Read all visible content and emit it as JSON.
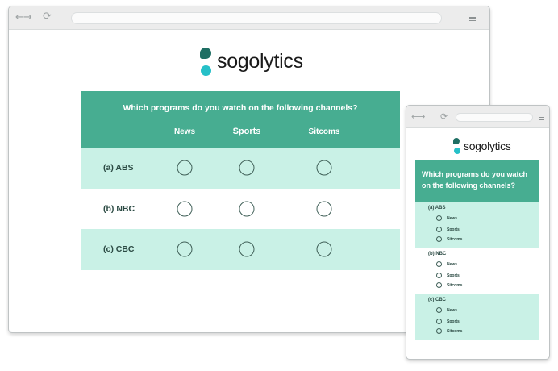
{
  "brand": {
    "name": "sogolytics",
    "colors": {
      "primary": "#47ad91",
      "mint": "#c9f1e6",
      "logo_dark": "#1e6e63",
      "logo_light": "#26c0c8"
    }
  },
  "browser": {
    "back_forward_icon": "back-forward-arrows",
    "back_forward_glyph": "←→",
    "reload_icon": "reload",
    "reload_glyph": "⟳",
    "menu_icon": "hamburger-menu"
  },
  "desktop": {
    "question": "Which programs do you watch on the  following channels?",
    "columns": [
      "News",
      "Sports",
      "Sitcoms"
    ],
    "rows": [
      "(a) ABS",
      "(b) NBC",
      "(c) CBC"
    ]
  },
  "mobile": {
    "question": "Which programs do you watch on the  following channels?",
    "groups": [
      {
        "label": "(a) ABS",
        "options": [
          "News",
          "Sports",
          "Sitcoms"
        ]
      },
      {
        "label": "(b) NBC",
        "options": [
          "News",
          "Sports",
          "Sitcoms"
        ]
      },
      {
        "label": "(c) CBC",
        "options": [
          "News",
          "Sports",
          "Sitcoms"
        ]
      }
    ]
  }
}
